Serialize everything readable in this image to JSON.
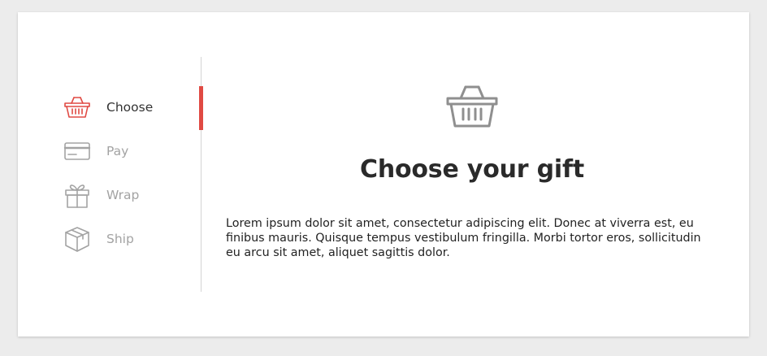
{
  "colors": {
    "accent": "#e04a43",
    "inactive": "#a3a3a3",
    "text": "#2a2a2a",
    "background": "#ececec",
    "card": "#ffffff"
  },
  "steps": [
    {
      "label": "Choose",
      "icon": "basket-icon",
      "active": true
    },
    {
      "label": "Pay",
      "icon": "credit-card-icon",
      "active": false
    },
    {
      "label": "Wrap",
      "icon": "gift-icon",
      "active": false
    },
    {
      "label": "Ship",
      "icon": "box-icon",
      "active": false
    }
  ],
  "content": {
    "icon": "basket-icon",
    "title": "Choose your gift",
    "description": "Lorem ipsum dolor sit amet, consectetur adipiscing elit. Donec at viverra est, eu finibus mauris. Quisque tempus vestibulum fringilla. Morbi tortor eros, sollicitudin eu arcu sit amet, aliquet sagittis dolor."
  }
}
